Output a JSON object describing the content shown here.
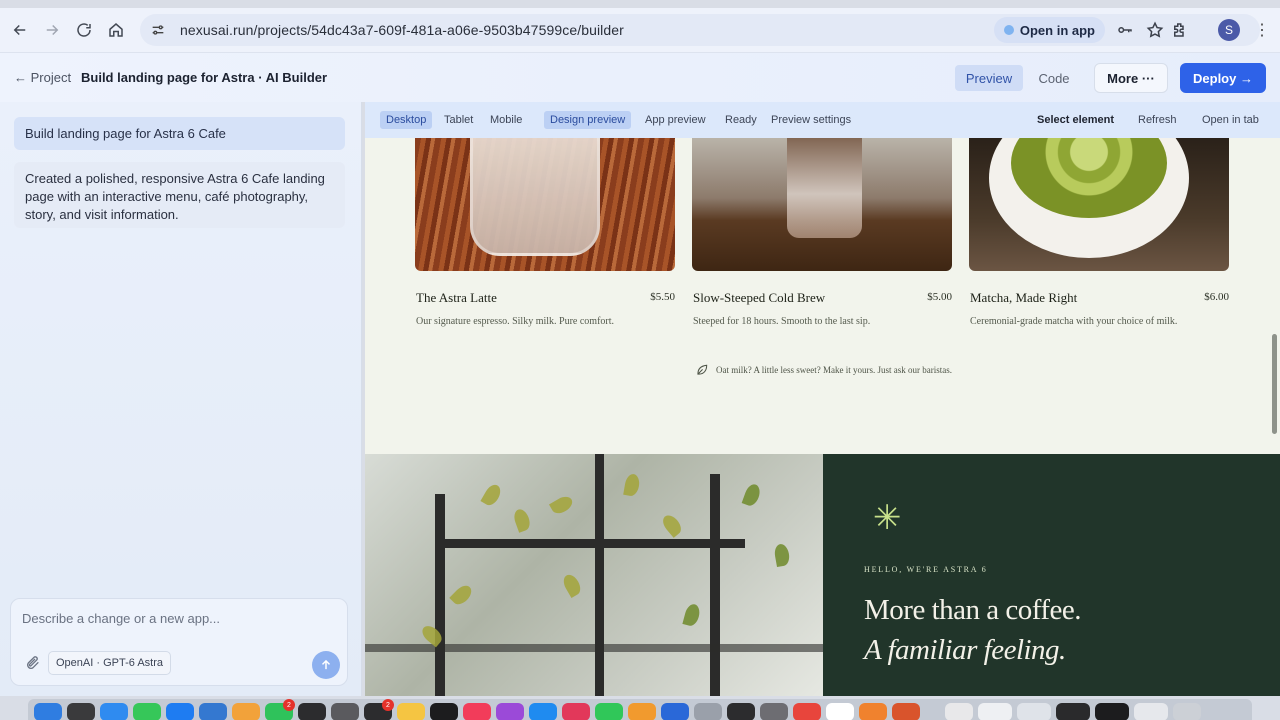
{
  "browser": {
    "url": "nexusai.run/projects/54dc43a7-609f-481a-a06e-9503b47599ce/builder",
    "open_in_app": "Open in app",
    "profile_initial": "S"
  },
  "header": {
    "back_label": "← Project",
    "title": "Build landing page for Astra · AI Builder",
    "tabs": [
      {
        "label": "Preview",
        "active": true
      },
      {
        "label": "Code",
        "active": false
      }
    ],
    "more_label": "More ···",
    "deploy_label": "Deploy →"
  },
  "sidebar": {
    "prompt": "Build landing page for Astra 6 Cafe",
    "reply": "Created a polished, responsive Astra 6 Cafe landing page with an interactive menu, café photography, story, and visit information.",
    "composer": {
      "placeholder": "Describe a change or a new app...",
      "model": "OpenAI · GPT-6 Astra"
    }
  },
  "preview_toolbar": {
    "devices": [
      "Desktop",
      "Tablet",
      "Mobile"
    ],
    "modes": [
      "Design preview",
      "App preview"
    ],
    "status": "Ready",
    "settings": "Preview settings",
    "select_element": "Select element",
    "refresh": "Refresh",
    "open_in_tab": "Open in tab"
  },
  "site": {
    "menu_items": [
      {
        "name": "The Astra Latte",
        "price": "$5.50",
        "desc": "Our signature espresso. Silky milk. Pure comfort."
      },
      {
        "name": "Slow-Steeped Cold Brew",
        "price": "$5.00",
        "desc": "Steeped for 18 hours. Smooth to the last sip."
      },
      {
        "name": "Matcha, Made Right",
        "price": "$6.00",
        "desc": "Ceremonial-grade matcha with your choice of milk."
      }
    ],
    "menu_note": "Oat milk? A little less sweet? Make it yours. Just ask our baristas.",
    "story": {
      "eyebrow": "HELLO, WE'RE ASTRA 6",
      "headline": "More than a coffee.",
      "headline_italic": "A familiar feeling."
    }
  },
  "dock": {
    "badges": [
      "2",
      "2"
    ]
  },
  "colors": {
    "accent": "#2e62e8",
    "story_bg": "#21352a",
    "asterisk": "#c7e08a"
  }
}
